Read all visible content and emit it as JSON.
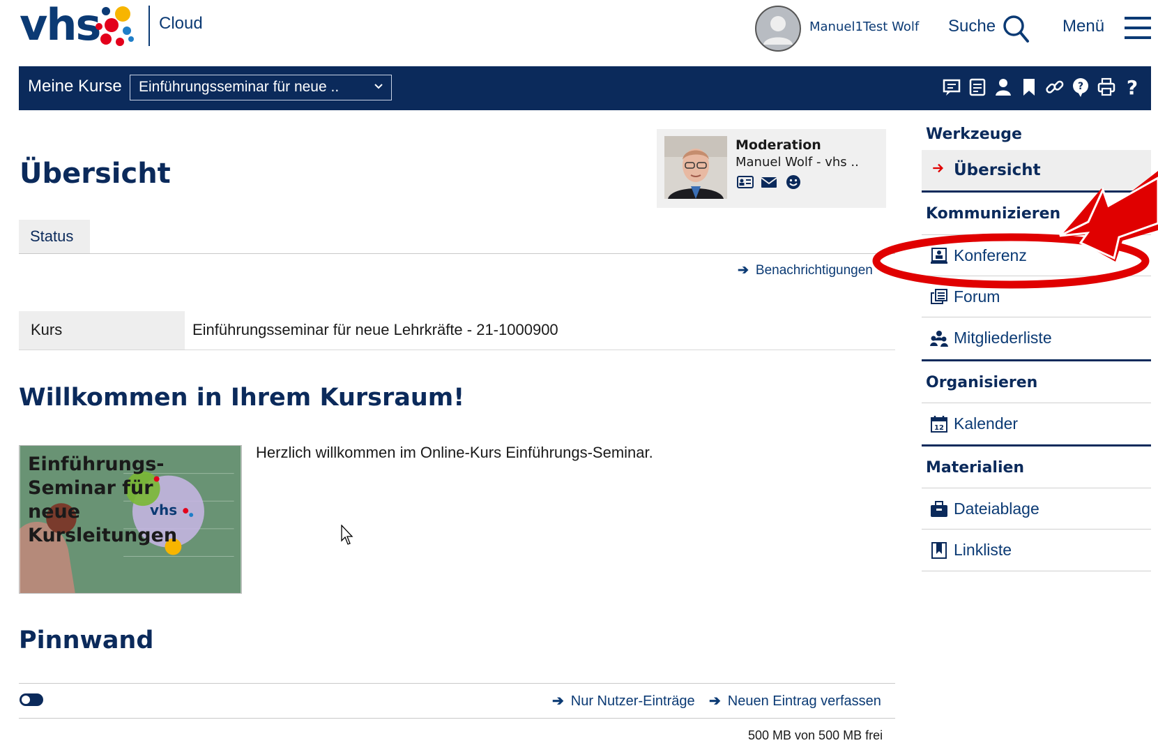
{
  "header": {
    "logo_text": "vhs",
    "cloud_label": "Cloud",
    "username": "Manuel1Test Wolf",
    "search_label": "Suche",
    "menu_label": "Menü"
  },
  "navbar": {
    "label": "Meine Kurse",
    "course_select_value": "Einführungsseminar für neue ..",
    "toolbar_icons": [
      "chat-icon",
      "notes-icon",
      "user-icon",
      "bookmark-icon",
      "link-icon",
      "help-bubble-icon",
      "print-icon",
      "question-icon"
    ]
  },
  "main": {
    "title": "Übersicht",
    "moderation": {
      "title": "Moderation",
      "name": "Manuel Wolf - vhs ..",
      "icons": [
        "vcard-icon",
        "envelope-icon",
        "smiley-icon"
      ]
    },
    "tab_status": "Status",
    "notifications_link": "Benachrichtigungen",
    "kurs_label": "Kurs",
    "kurs_value": "Einführungsseminar für neue Lehrkräfte - 21-1000900",
    "welcome_heading": "Willkommen in Ihrem Kursraum!",
    "course_image_text": [
      "Einführungs-",
      "Seminar für",
      "neue",
      "Kursleitungen"
    ],
    "course_image_logo": "vhs",
    "welcome_text": "Herzlich willkommen im Online-Kurs Einführungs-Seminar.",
    "pinnwand_heading": "Pinnwand",
    "nur_link": "Nur Nutzer-Einträge",
    "neu_link": "Neuen Eintrag verfassen",
    "storage": "500 MB von 500 MB frei"
  },
  "sidebar": {
    "werkzeuge": "Werkzeuge",
    "uebersicht": "Übersicht",
    "kommunizieren": "Kommunizieren",
    "konferenz": "Konferenz",
    "forum": "Forum",
    "mitglieder": "Mitgliederliste",
    "organisieren": "Organisieren",
    "kalender": "Kalender",
    "kalender_icon_day": "12",
    "materialien": "Materialien",
    "dateiablage": "Dateiablage",
    "linkliste": "Linkliste"
  },
  "colors": {
    "brand_dark": "#0b2a5b",
    "link_blue": "#0b3a74",
    "annotation_red": "#e00000"
  }
}
